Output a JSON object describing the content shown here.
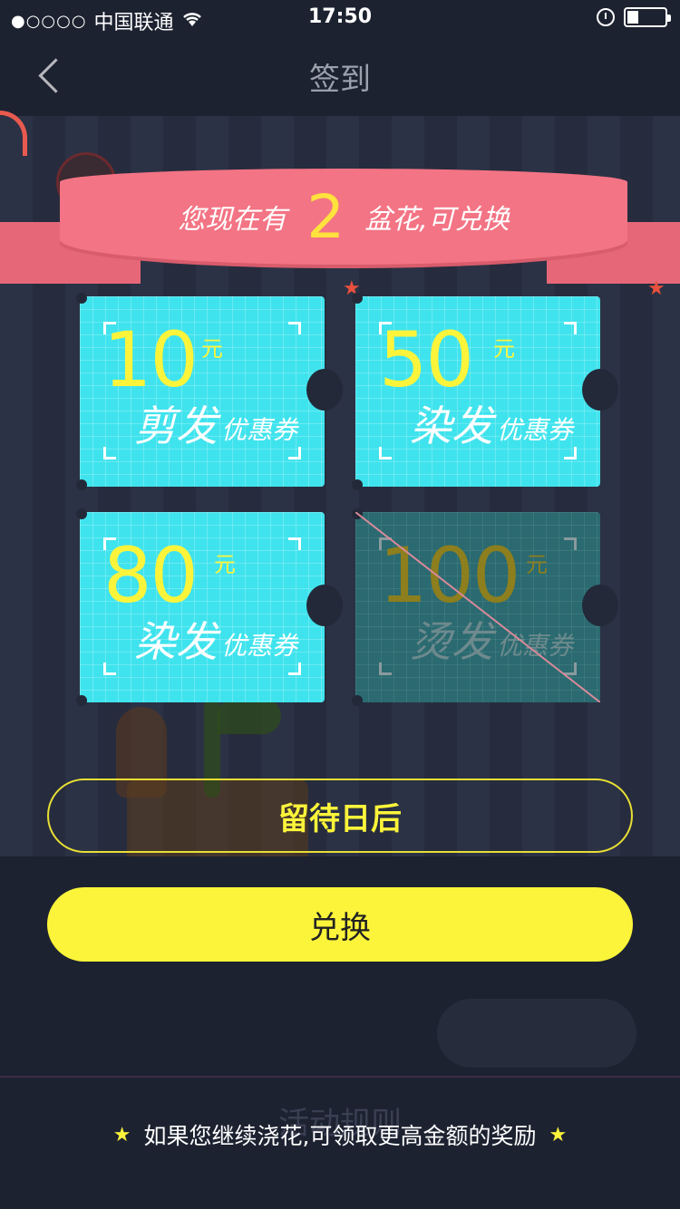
{
  "status_bar": {
    "signal": "●○○○○",
    "carrier": "中国联通",
    "time": "17:50"
  },
  "nav": {
    "title": "签到"
  },
  "background": {
    "rules_title": "活动规则"
  },
  "banner": {
    "prefix": "您现在有",
    "count": "2",
    "suffix": "盆花,可兑换"
  },
  "coupons": [
    {
      "amount": "10",
      "unit": "元",
      "service": "剪发",
      "type": "优惠券",
      "enabled": true
    },
    {
      "amount": "50",
      "unit": "元",
      "service": "染发",
      "type": "优惠券",
      "enabled": true
    },
    {
      "amount": "80",
      "unit": "元",
      "service": "染发",
      "type": "优惠券",
      "enabled": true
    },
    {
      "amount": "100",
      "unit": "元",
      "service": "烫发",
      "type": "优惠券",
      "enabled": false
    }
  ],
  "actions": {
    "later_label": "留待日后",
    "exchange_label": "兑换"
  },
  "hint": {
    "text": "如果您继续浇花,可领取更高金额的奖励"
  },
  "colors": {
    "coupon_active": "#3fe3ed",
    "coupon_disabled": "#2a6a70",
    "accent_yellow": "#fcf43a",
    "ribbon": "#f37484"
  }
}
